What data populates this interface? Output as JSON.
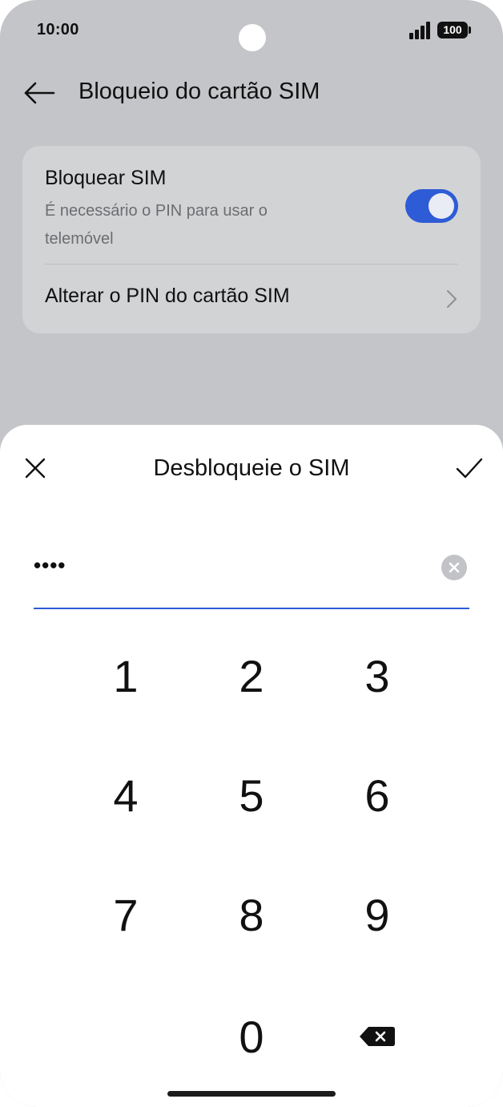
{
  "status_bar": {
    "time": "10:00",
    "battery": "100",
    "icons": [
      "signal-icon",
      "battery-icon"
    ]
  },
  "header": {
    "title": "Bloqueio do cartão SIM",
    "back_icon": "arrow-left-icon"
  },
  "settings": {
    "lock_sim": {
      "title": "Bloquear SIM",
      "subtitle": "É necessário o PIN para usar o telemóvel",
      "enabled": true
    },
    "change_pin": {
      "title": "Alterar o PIN do cartão SIM",
      "icon": "chevron-right-icon"
    }
  },
  "dialog": {
    "title": "Desbloqueie o SIM",
    "close_icon": "close-icon",
    "confirm_icon": "check-icon",
    "pin_value": "••••",
    "clear_icon": "clear-icon"
  },
  "keypad": {
    "keys": [
      "1",
      "2",
      "3",
      "4",
      "5",
      "6",
      "7",
      "8",
      "9",
      "0"
    ],
    "backspace_icon": "backspace-icon"
  },
  "colors": {
    "accent": "#2e5bd6",
    "scrim_background": "#c4c5c8",
    "card_background": "#d2d3d5",
    "sheet_background": "#ffffff"
  }
}
